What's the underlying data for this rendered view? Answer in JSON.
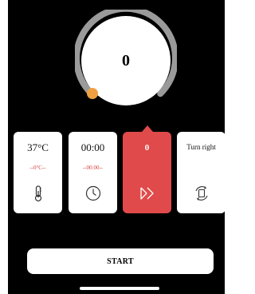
{
  "dial": {
    "value": "0",
    "progress_fraction": 0.0
  },
  "cards": {
    "temperature": {
      "value": "37°C",
      "sub": "--0°C--",
      "icon": "thermometer-icon"
    },
    "time": {
      "value": "00:00",
      "sub": "--00:00--",
      "icon": "clock-icon"
    },
    "speed": {
      "value": "0",
      "icon": "fast-forward-icon",
      "selected": true
    },
    "direction": {
      "value": "Turn right",
      "icon": "rotate-icon"
    }
  },
  "start_button": {
    "label": "START"
  },
  "colors": {
    "background": "#000000",
    "accent_red": "#e04a4a",
    "knob_orange": "#f0a040",
    "track_gray": "#9a9a9a"
  }
}
